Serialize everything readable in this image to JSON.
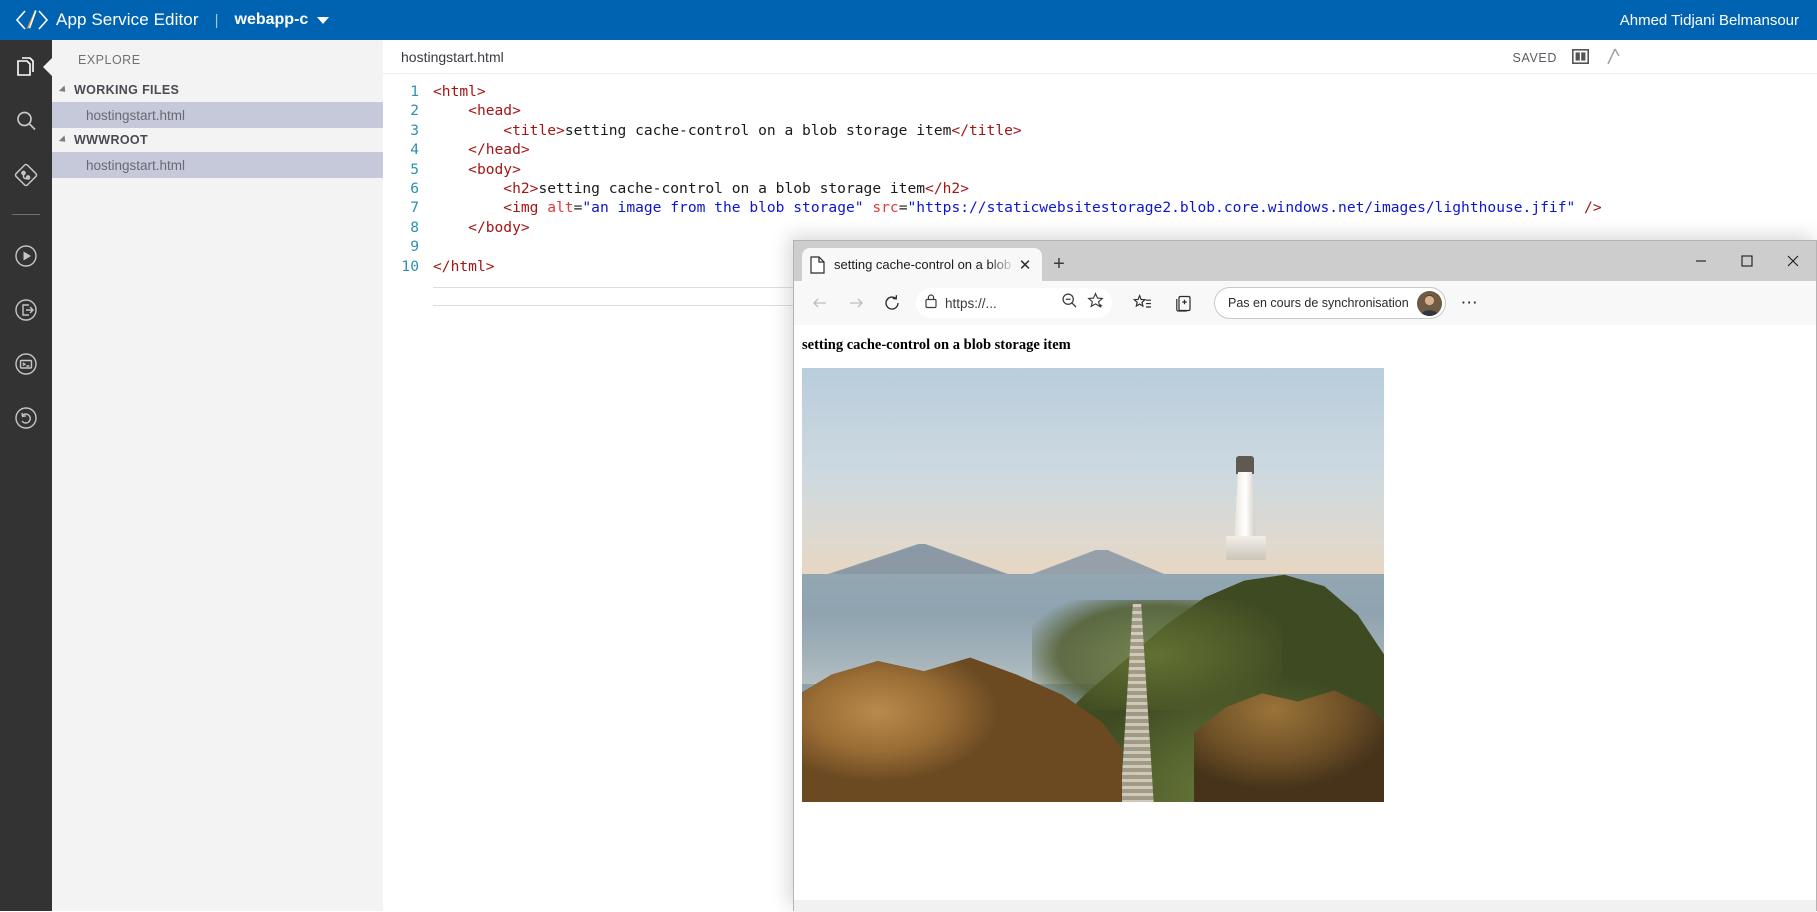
{
  "topbar": {
    "app_title": "App Service Editor",
    "separator": "|",
    "site_name": "webapp-c",
    "user_name": "Ahmed Tidjani Belmansour",
    "background_color": "#0063b1"
  },
  "activity_bar": {
    "items": [
      {
        "name": "explorer-icon",
        "label": "Explorer",
        "active": true
      },
      {
        "name": "search-icon",
        "label": "Search",
        "active": false
      },
      {
        "name": "source-control-icon",
        "label": "Source Control",
        "active": false
      },
      {
        "name": "run-icon",
        "label": "Run",
        "active": false
      },
      {
        "name": "open-in-browser-icon",
        "label": "Open in browser",
        "active": false
      },
      {
        "name": "console-icon",
        "label": "Console",
        "active": false
      },
      {
        "name": "restart-icon",
        "label": "Restart",
        "active": false
      }
    ]
  },
  "sidebar": {
    "title": "EXPLORE",
    "sections": [
      {
        "label": "WORKING FILES",
        "expanded": true,
        "files": [
          "hostingstart.html"
        ]
      },
      {
        "label": "WWWROOT",
        "expanded": true,
        "files": [
          "hostingstart.html"
        ]
      }
    ]
  },
  "editor": {
    "tab_name": "hostingstart.html",
    "status": "SAVED",
    "split_icon": "split-editor-icon",
    "more_icon": "more-actions-icon",
    "lines": [
      {
        "n": "1",
        "indent": 0,
        "parts": [
          {
            "t": "tg",
            "s": "<html>"
          }
        ]
      },
      {
        "n": "2",
        "indent": 1,
        "parts": [
          {
            "t": "tg",
            "s": "<head>"
          }
        ]
      },
      {
        "n": "3",
        "indent": 2,
        "parts": [
          {
            "t": "tg",
            "s": "<title>"
          },
          {
            "t": "tx",
            "s": "setting cache-control on a blob storage item"
          },
          {
            "t": "tg",
            "s": "</title>"
          }
        ]
      },
      {
        "n": "4",
        "indent": 1,
        "parts": [
          {
            "t": "tg",
            "s": "</head>"
          }
        ]
      },
      {
        "n": "5",
        "indent": 1,
        "parts": [
          {
            "t": "tg",
            "s": "<body>"
          }
        ]
      },
      {
        "n": "6",
        "indent": 2,
        "parts": [
          {
            "t": "tg",
            "s": "<h2>"
          },
          {
            "t": "tx",
            "s": "setting cache-control on a blob storage item"
          },
          {
            "t": "tg",
            "s": "</h2>"
          }
        ]
      },
      {
        "n": "7",
        "indent": 2,
        "parts": [
          {
            "t": "tg",
            "s": "<img "
          },
          {
            "t": "at",
            "s": "alt"
          },
          {
            "t": "tx",
            "s": "="
          },
          {
            "t": "st",
            "s": "\"an image from the blob storage\""
          },
          {
            "t": "tx",
            "s": " "
          },
          {
            "t": "at",
            "s": "src"
          },
          {
            "t": "tx",
            "s": "="
          },
          {
            "t": "st",
            "s": "\"https://staticwebsitestorage2.blob.core.windows.net/images/lighthouse.jfif\""
          },
          {
            "t": "tg",
            "s": " />"
          }
        ]
      },
      {
        "n": "8",
        "indent": 1,
        "parts": [
          {
            "t": "tg",
            "s": "</body>"
          }
        ]
      },
      {
        "n": "9",
        "indent": 0,
        "parts": [
          {
            "t": "tx",
            "s": ""
          }
        ]
      },
      {
        "n": "10",
        "indent": 0,
        "parts": [
          {
            "t": "tg",
            "s": "</html>"
          }
        ]
      }
    ]
  },
  "browser": {
    "tab": {
      "title": "setting cache-control on a blob storage item",
      "icon": "page-icon",
      "close_label": "✕",
      "new_tab_label": "+"
    },
    "window_controls": {
      "minimize": "—",
      "maximize": "☐",
      "close": "✕"
    },
    "nav": {
      "back": "back-arrow-icon",
      "forward": "forward-arrow-icon",
      "reload": "reload-icon",
      "lock": "lock-icon",
      "url": "https://...",
      "zoom": "zoom-out-icon",
      "favorite": "add-favorite-star-icon",
      "favorites": "favorites-list-icon",
      "collections": "collections-icon",
      "sync_text": "Pas en cours de synchronisation",
      "avatar": "user-avatar",
      "menu": "⋯"
    },
    "page": {
      "heading": "setting cache-control on a blob storage item",
      "image_alt": "an image from the blob storage"
    }
  }
}
